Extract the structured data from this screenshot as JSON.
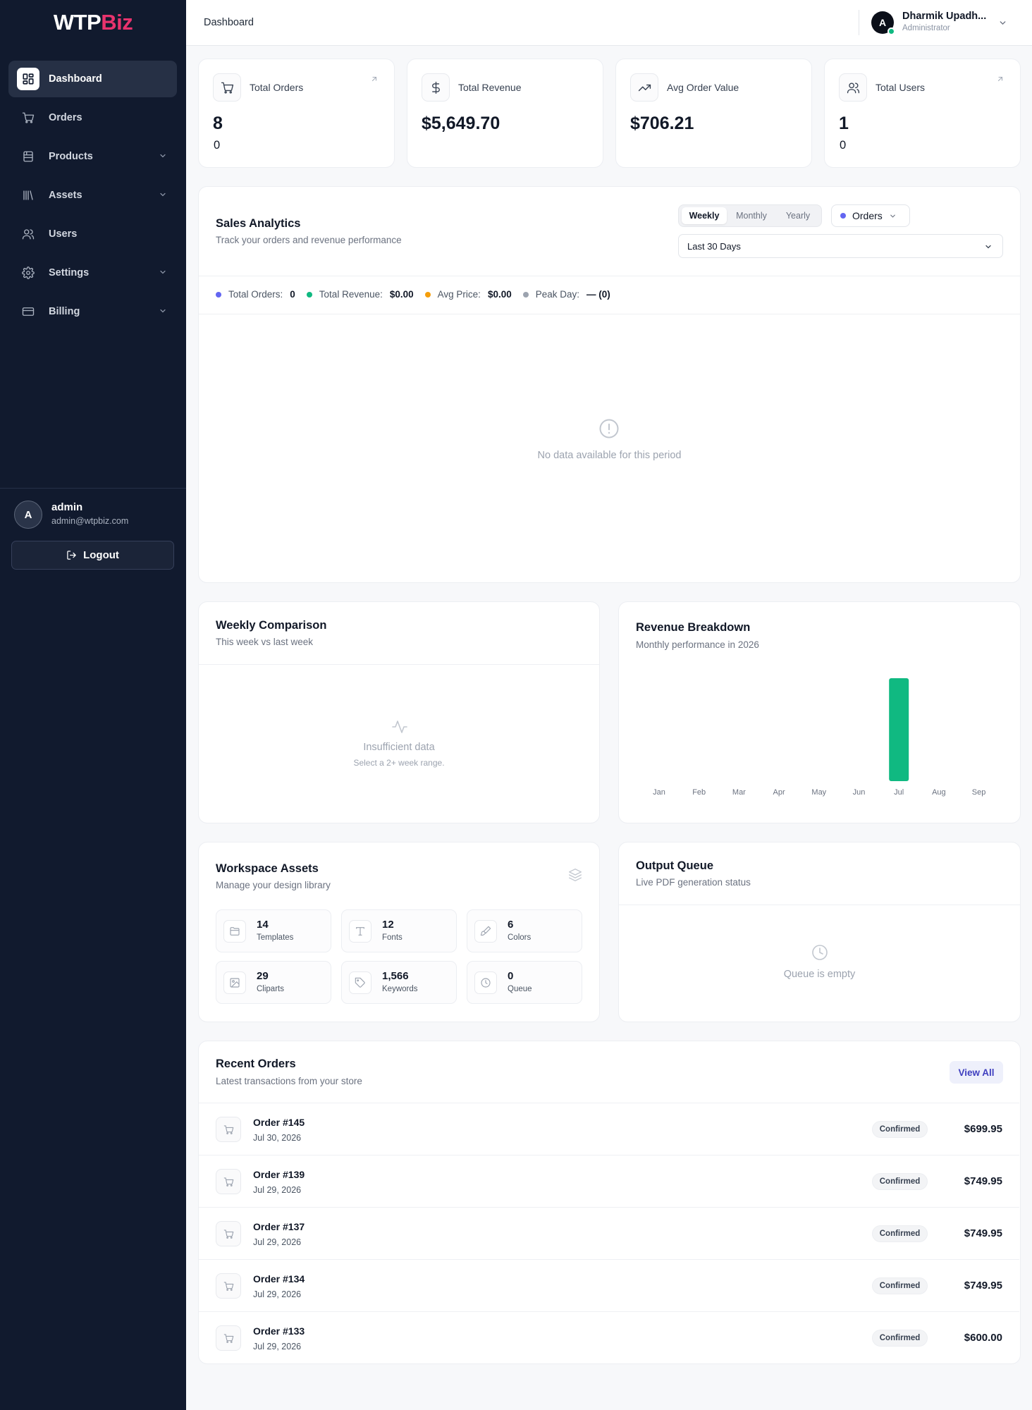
{
  "brand": {
    "part1": "WTP",
    "part2": "Biz"
  },
  "sidebar": {
    "items": [
      {
        "label": "Dashboard",
        "icon": "dashboard-icon",
        "active": true,
        "expandable": false
      },
      {
        "label": "Orders",
        "icon": "cart-icon",
        "active": false,
        "expandable": false
      },
      {
        "label": "Products",
        "icon": "box-icon",
        "active": false,
        "expandable": true
      },
      {
        "label": "Assets",
        "icon": "library-icon",
        "active": false,
        "expandable": true
      },
      {
        "label": "Users",
        "icon": "users-icon",
        "active": false,
        "expandable": false
      },
      {
        "label": "Settings",
        "icon": "gear-icon",
        "active": false,
        "expandable": true
      },
      {
        "label": "Billing",
        "icon": "credit-card-icon",
        "active": false,
        "expandable": true
      }
    ],
    "user": {
      "initial": "A",
      "name": "admin",
      "email": "admin@wtpbiz.com"
    },
    "logout_label": "Logout"
  },
  "header": {
    "breadcrumb": "Dashboard",
    "user": {
      "initial": "A",
      "name": "Dharmik Upadh...",
      "role": "Administrator",
      "online": true
    }
  },
  "stats": [
    {
      "label": "Total Orders",
      "value": "8",
      "sub": "0",
      "icon": "cart-icon"
    },
    {
      "label": "Total Revenue",
      "value": "$5,649.70",
      "sub": "",
      "icon": "dollar-icon"
    },
    {
      "label": "Avg Order Value",
      "value": "$706.21",
      "sub": "",
      "icon": "trending-up-icon"
    },
    {
      "label": "Total Users",
      "value": "1",
      "sub": "0",
      "icon": "users-icon"
    }
  ],
  "sales_analytics": {
    "title": "Sales Analytics",
    "subtitle": "Track your orders and revenue performance",
    "periods": [
      "Weekly",
      "Monthly",
      "Yearly"
    ],
    "selected_period": "Weekly",
    "metric": "Orders",
    "range": "Last 30 Days",
    "legend": [
      {
        "label": "Total Orders:",
        "value": "0",
        "color": "#6366f1"
      },
      {
        "label": "Total Revenue:",
        "value": "$0.00",
        "color": "#10b981"
      },
      {
        "label": "Avg Price:",
        "value": "$0.00",
        "color": "#f59e0b"
      },
      {
        "label": "Peak Day:",
        "value": "— (0)",
        "color": "#9ca3af"
      }
    ],
    "empty_message": "No data available for this period"
  },
  "weekly_comparison": {
    "title": "Weekly Comparison",
    "subtitle": "This week vs last week",
    "empty_title": "Insufficient data",
    "empty_sub": "Select a 2+ week range."
  },
  "revenue_breakdown": {
    "title": "Revenue Breakdown",
    "subtitle": "Monthly performance in 2026"
  },
  "chart_data": {
    "type": "bar",
    "categories": [
      "Jan",
      "Feb",
      "Mar",
      "Apr",
      "May",
      "Jun",
      "Jul",
      "Aug",
      "Sep"
    ],
    "values": [
      0,
      0,
      0,
      0,
      0,
      0,
      5649.7,
      0,
      0
    ],
    "bar_color": "#10b981",
    "grid": false
  },
  "workspace_assets": {
    "title": "Workspace Assets",
    "subtitle": "Manage your design library",
    "items": [
      {
        "count": "14",
        "label": "Templates",
        "icon": "folder-icon"
      },
      {
        "count": "12",
        "label": "Fonts",
        "icon": "type-icon"
      },
      {
        "count": "6",
        "label": "Colors",
        "icon": "brush-icon"
      },
      {
        "count": "29",
        "label": "Cliparts",
        "icon": "image-icon"
      },
      {
        "count": "1,566",
        "label": "Keywords",
        "icon": "tag-icon"
      },
      {
        "count": "0",
        "label": "Queue",
        "icon": "clock-icon"
      }
    ]
  },
  "output_queue": {
    "title": "Output Queue",
    "subtitle": "Live PDF generation status",
    "empty_message": "Queue is empty"
  },
  "recent_orders": {
    "title": "Recent Orders",
    "subtitle": "Latest transactions from your store",
    "view_all_label": "View All",
    "rows": [
      {
        "id": "Order #145",
        "date": "Jul 30, 2026",
        "status": "Confirmed",
        "amount": "$699.95"
      },
      {
        "id": "Order #139",
        "date": "Jul 29, 2026",
        "status": "Confirmed",
        "amount": "$749.95"
      },
      {
        "id": "Order #137",
        "date": "Jul 29, 2026",
        "status": "Confirmed",
        "amount": "$749.95"
      },
      {
        "id": "Order #134",
        "date": "Jul 29, 2026",
        "status": "Confirmed",
        "amount": "$749.95"
      },
      {
        "id": "Order #133",
        "date": "Jul 29, 2026",
        "status": "Confirmed",
        "amount": "$600.00"
      }
    ]
  }
}
